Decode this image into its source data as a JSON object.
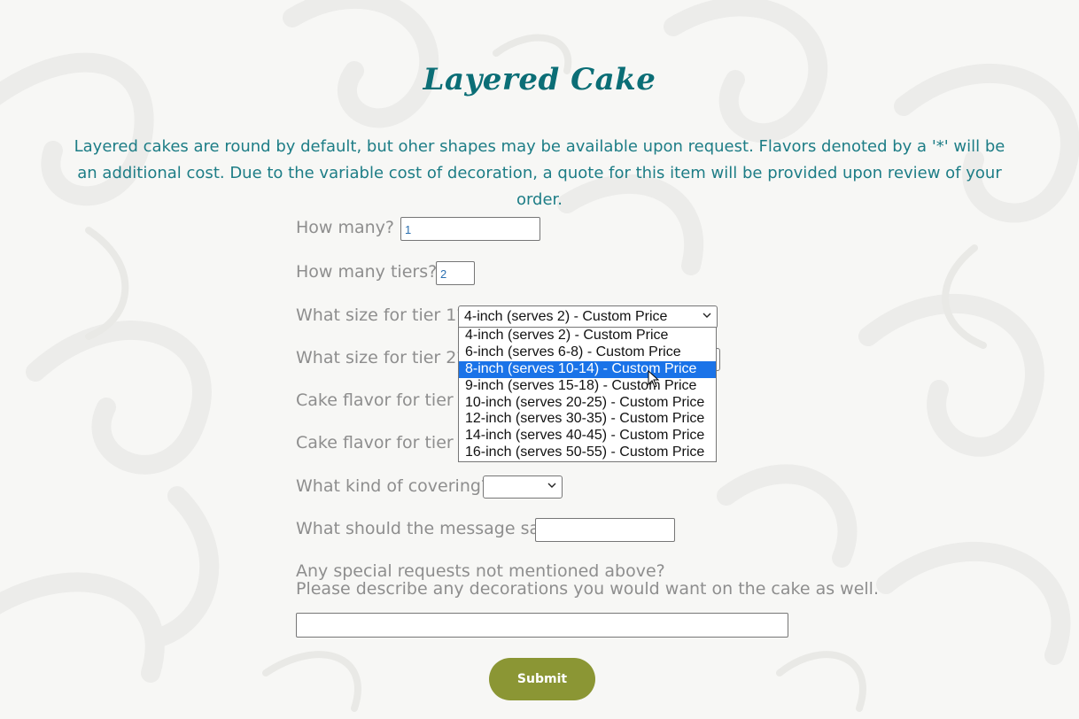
{
  "title": "Layered Cake",
  "intro": "Layered cakes are round by default, but oher shapes may be available upon request. Flavors denoted by a '*' will be an additional cost. Due to the variable cost of decoration, a quote for this item will be provided upon review of your order.",
  "form": {
    "how_many": {
      "label": "How many?",
      "value": "1"
    },
    "tiers": {
      "label": "How many tiers?",
      "value": "2"
    },
    "tier1_size": {
      "label": "What size for tier 1?",
      "value": "4-inch (serves 2) - Custom Price"
    },
    "tier2_size": {
      "label": "What size for tier 2?"
    },
    "flavor1": {
      "label": "Cake flavor for tier 1:"
    },
    "flavor2": {
      "label": "Cake flavor for tier 2:"
    },
    "covering": {
      "label": "What kind of covering?",
      "value": ""
    },
    "message": {
      "label": "What should the message say?",
      "value": ""
    },
    "special": {
      "label_line1": "Any special requests not mentioned above?",
      "label_line2": "Please describe any decorations you would want on the cake as well.",
      "value": ""
    },
    "submit_label": "Submit"
  },
  "size_options": [
    "4-inch (serves 2) - Custom Price",
    "6-inch (serves 6-8) - Custom Price",
    "8-inch (serves 10-14) - Custom Price",
    "9-inch (serves 15-18) - Custom Price",
    "10-inch (serves 20-25) - Custom Price",
    "12-inch (serves 30-35) - Custom Price",
    "14-inch (serves 40-45) - Custom Price",
    "16-inch (serves 50-55) - Custom Price"
  ],
  "highlighted_option_index": 2,
  "colors": {
    "title": "#0b6e76",
    "intro": "#1d7d86",
    "label": "#8e8e8e",
    "submit_bg": "#8b9634",
    "highlight": "#1a73e8"
  },
  "icons": {
    "select_arrow": "chevron-down-icon",
    "pointer": "mouse-cursor-icon"
  }
}
